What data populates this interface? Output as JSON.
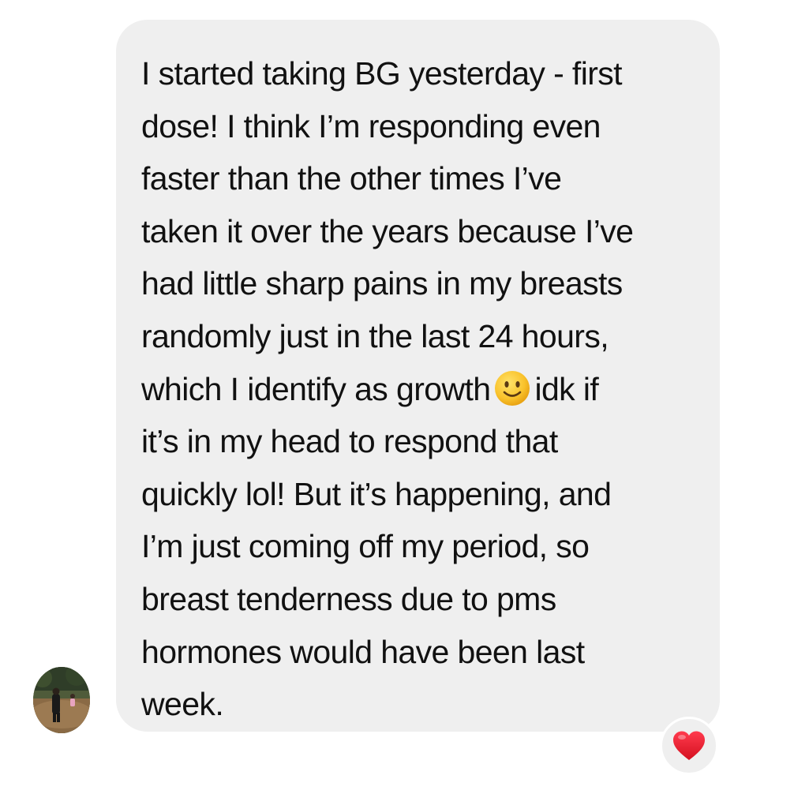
{
  "message": {
    "lines": [
      "I started taking BG yesterday - first",
      "dose! I think I’m responding even",
      "faster than the other times I’ve",
      "taken it over the years because I’ve",
      "had little sharp pains in my breasts",
      "randomly just in the last 24 hours,",
      "which I identify as growth",
      "idk if",
      "it’s in my head to respond that",
      "quickly lol! But it’s happening, and",
      "I’m just coming off my period, so",
      "breast tenderness due to pms",
      "hormones would have been last",
      "week."
    ],
    "emoji": "slightly-smiling-face-icon"
  },
  "reaction": {
    "icon": "heart-icon",
    "color": "#e8162a"
  },
  "colors": {
    "bubble": "#efefef",
    "text": "#111111",
    "background": "#ffffff"
  }
}
